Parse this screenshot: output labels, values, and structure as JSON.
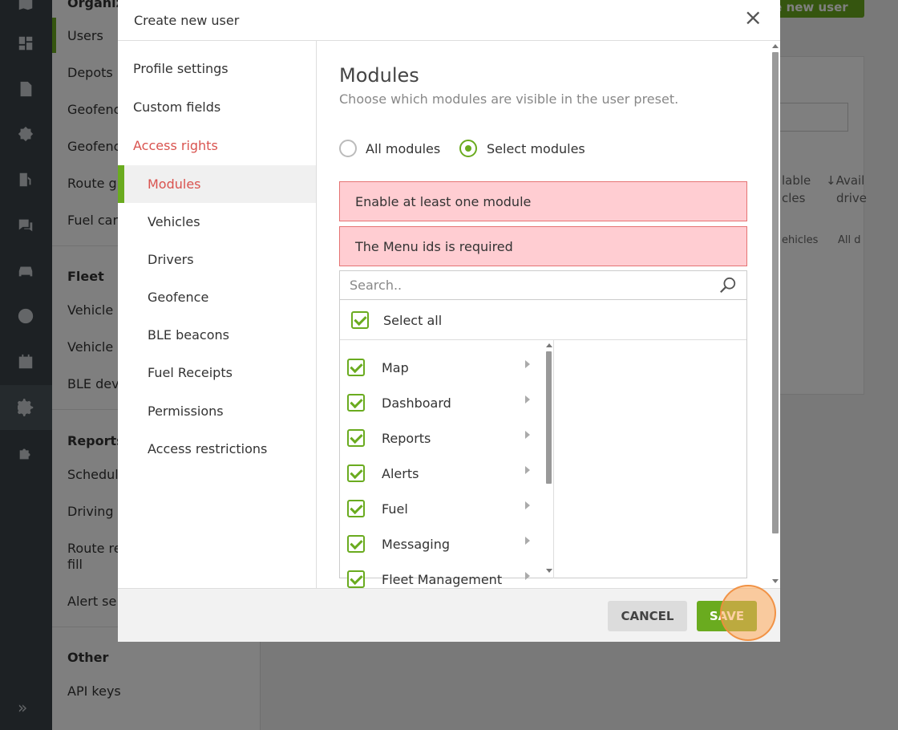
{
  "background": {
    "sidebar": {
      "items_top": [
        "Organiz",
        "Users",
        "Depots",
        "Geofenc",
        "Geofenc",
        "Route g",
        "Fuel car"
      ],
      "fleet_header": "Fleet",
      "fleet_items": [
        "Vehicle",
        "Vehicle",
        "BLE dev"
      ],
      "reports_header": "Reports",
      "reports_items": [
        "Schedul",
        "Driving",
        "Route re",
        "fill",
        "Alert se"
      ],
      "other_header": "Other",
      "other_items": [
        "API keys"
      ]
    },
    "create_button": "te new user",
    "table_fragments": {
      "col1_line1": "lable",
      "col1_line2": "cles",
      "col2_line1": "↓Avail",
      "col2_line2": "drive",
      "filter1": "ehicles",
      "filter2": "All d"
    },
    "rail_icons": [
      "map-icon",
      "dashboard-icon",
      "report-icon",
      "alert-icon",
      "fuel-icon",
      "messaging-icon",
      "vehicle-icon",
      "user-icon",
      "calendar-icon",
      "settings-icon",
      "puzzle-icon"
    ]
  },
  "modal": {
    "title": "Create new user",
    "nav": {
      "profile_settings": "Profile settings",
      "custom_fields": "Custom fields",
      "access_rights": "Access rights",
      "modules": "Modules",
      "vehicles": "Vehicles",
      "drivers": "Drivers",
      "geofence": "Geofence",
      "ble_beacons": "BLE beacons",
      "fuel_receipts": "Fuel Receipts",
      "permissions": "Permissions",
      "access_restrictions": "Access restrictions"
    },
    "content": {
      "title": "Modules",
      "subtitle": "Choose which modules are visible in the user preset.",
      "radio_all": "All modules",
      "radio_select": "Select modules",
      "selected_radio": "Select modules",
      "alert_1": "Enable at least one module",
      "alert_2": "The Menu ids is required",
      "search_placeholder": "Search..",
      "select_all": "Select all",
      "modules": [
        "Map",
        "Dashboard",
        "Reports",
        "Alerts",
        "Fuel",
        "Messaging",
        "Fleet Management"
      ]
    },
    "footer": {
      "cancel": "CANCEL",
      "save": "SAVE"
    }
  },
  "colors": {
    "accent": "#6aab1f",
    "error_bg": "#ffcdd2",
    "error_text": "#d9534f"
  }
}
